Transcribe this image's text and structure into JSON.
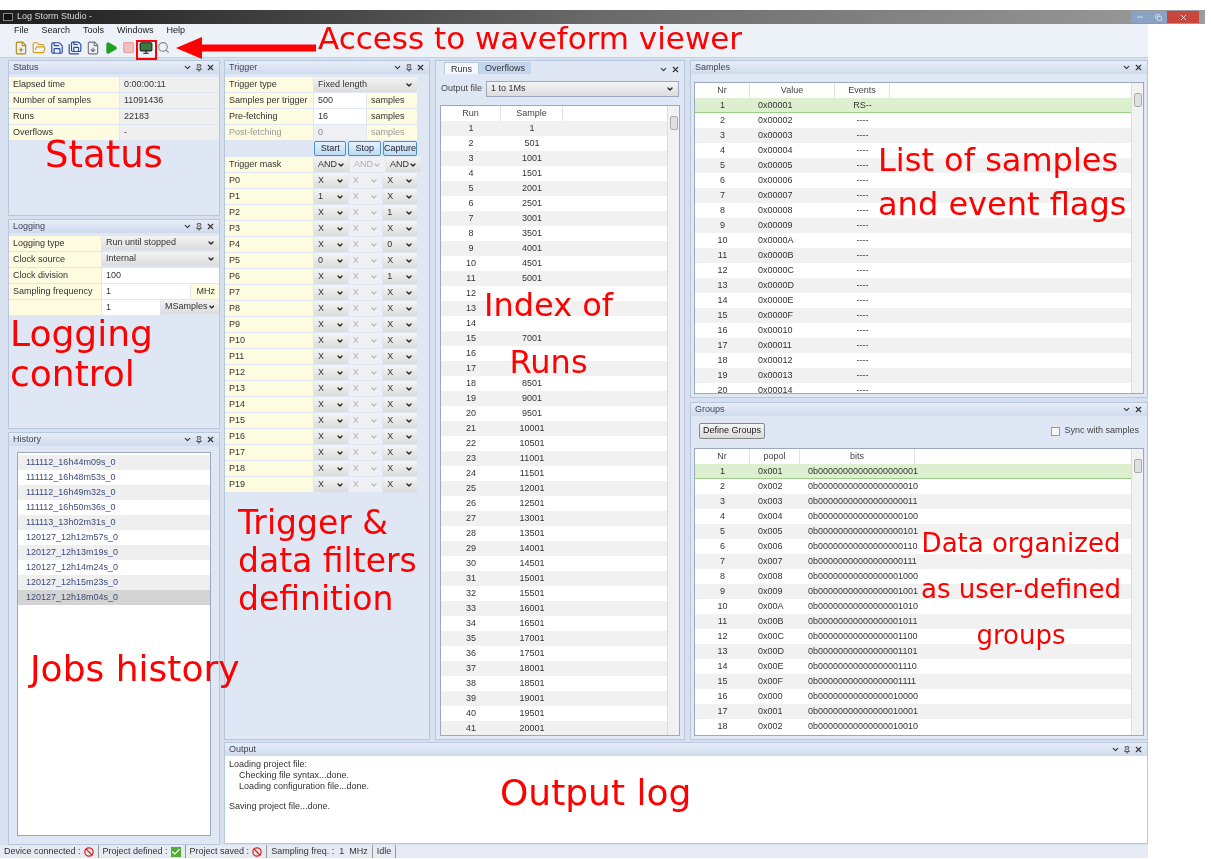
{
  "window": {
    "title": "Log Storm Studio -"
  },
  "menu": [
    "File",
    "Search",
    "Tools",
    "Windows",
    "Help"
  ],
  "status_panel": {
    "title": "Status",
    "rows": [
      {
        "label": "Elapsed time",
        "value": "0:00:00:11"
      },
      {
        "label": "Number of samples",
        "value": "11091436"
      },
      {
        "label": "Runs",
        "value": "22183"
      },
      {
        "label": "Overflows",
        "value": "-"
      }
    ]
  },
  "logging": {
    "title": "Logging",
    "settings": [
      {
        "kind": "select",
        "label": "Logging type",
        "value": "Run until stopped"
      },
      {
        "kind": "select",
        "label": "Clock source",
        "value": "Internal"
      },
      {
        "kind": "number",
        "label": "Clock division",
        "value": "100"
      },
      {
        "kind": "unit",
        "label": "Sampling frequency",
        "value": "1",
        "unit": "MHz"
      },
      {
        "kind": "unit_select",
        "value": "1",
        "unit": "MSamples"
      }
    ]
  },
  "history": {
    "title": "History",
    "items": [
      {
        "label": "111112_16h44m09s_0",
        "selected": false
      },
      {
        "label": "111112_16h48m53s_0",
        "selected": false
      },
      {
        "label": "111112_16h49m32s_0",
        "selected": false
      },
      {
        "label": "111112_16h50m36s_0",
        "selected": false
      },
      {
        "label": "111113_13h02m31s_0",
        "selected": false
      },
      {
        "label": "120127_12h12m57s_0",
        "selected": false
      },
      {
        "label": "120127_12h13m19s_0",
        "selected": false
      },
      {
        "label": "120127_12h14m24s_0",
        "selected": false
      },
      {
        "label": "120127_12h15m23s_0",
        "selected": false
      },
      {
        "label": "120127_12h18m04s_0",
        "selected": true
      }
    ]
  },
  "trigger": {
    "title": "Trigger",
    "settings": [
      {
        "kind": "select",
        "label": "Trigger type",
        "value": "Fixed length",
        "disabled": false
      },
      {
        "kind": "number",
        "label": "Samples per trigger",
        "value": "500",
        "unit": "samples",
        "disabled": false
      },
      {
        "kind": "number",
        "label": "Pre-fetching",
        "value": "16",
        "unit": "samples",
        "disabled": false
      },
      {
        "kind": "number",
        "label": "Post-fetching",
        "value": "0",
        "unit": "samples",
        "disabled": true
      }
    ],
    "buttons": [
      "Start",
      "Stop",
      "Capture"
    ],
    "mask": {
      "label": "Trigger mask",
      "values": [
        {
          "value": "AND",
          "disabled": false
        },
        {
          "value": "AND",
          "disabled": true
        },
        {
          "value": "AND",
          "disabled": false
        }
      ]
    },
    "pins": [
      {
        "label": "P0",
        "values": [
          "X",
          "X",
          "X"
        ]
      },
      {
        "label": "P1",
        "values": [
          "1",
          "X",
          "X"
        ]
      },
      {
        "label": "P2",
        "values": [
          "X",
          "X",
          "1"
        ]
      },
      {
        "label": "P3",
        "values": [
          "X",
          "X",
          "X"
        ]
      },
      {
        "label": "P4",
        "values": [
          "X",
          "X",
          "0"
        ]
      },
      {
        "label": "P5",
        "values": [
          "0",
          "X",
          "X"
        ]
      },
      {
        "label": "P6",
        "values": [
          "X",
          "X",
          "1"
        ]
      },
      {
        "label": "P7",
        "values": [
          "X",
          "X",
          "X"
        ]
      },
      {
        "label": "P8",
        "values": [
          "X",
          "X",
          "X"
        ]
      },
      {
        "label": "P9",
        "values": [
          "X",
          "X",
          "X"
        ]
      },
      {
        "label": "P10",
        "values": [
          "X",
          "X",
          "X"
        ]
      },
      {
        "label": "P11",
        "values": [
          "X",
          "X",
          "X"
        ]
      },
      {
        "label": "P12",
        "values": [
          "X",
          "X",
          "X"
        ]
      },
      {
        "label": "P13",
        "values": [
          "X",
          "X",
          "X"
        ]
      },
      {
        "label": "P14",
        "values": [
          "X",
          "X",
          "X"
        ]
      },
      {
        "label": "P15",
        "values": [
          "X",
          "X",
          "X"
        ]
      },
      {
        "label": "P16",
        "values": [
          "X",
          "X",
          "X"
        ]
      },
      {
        "label": "P17",
        "values": [
          "X",
          "X",
          "X"
        ]
      },
      {
        "label": "P18",
        "values": [
          "X",
          "X",
          "X"
        ]
      },
      {
        "label": "P19",
        "values": [
          "X",
          "X",
          "X"
        ]
      }
    ]
  },
  "runs": {
    "tabs": [
      {
        "label": "Runs",
        "selected": true
      },
      {
        "label": "Overflows",
        "selected": false
      }
    ],
    "output_file": {
      "label": "Output file",
      "value": "1 to 1Ms"
    },
    "columns": [
      "Run",
      "Sample"
    ],
    "rows": [
      {
        "run": "1",
        "sample": "1"
      },
      {
        "run": "2",
        "sample": "501"
      },
      {
        "run": "3",
        "sample": "1001"
      },
      {
        "run": "4",
        "sample": "1501"
      },
      {
        "run": "5",
        "sample": "2001"
      },
      {
        "run": "6",
        "sample": "2501"
      },
      {
        "run": "7",
        "sample": "3001"
      },
      {
        "run": "8",
        "sample": "3501"
      },
      {
        "run": "9",
        "sample": "4001"
      },
      {
        "run": "10",
        "sample": "4501"
      },
      {
        "run": "11",
        "sample": "5001"
      },
      {
        "run": "12"
      },
      {
        "run": "13"
      },
      {
        "run": "14"
      },
      {
        "run": "15",
        "sample": "7001"
      },
      {
        "run": "16"
      },
      {
        "run": "17"
      },
      {
        "run": "18",
        "sample": "8501"
      },
      {
        "run": "19",
        "sample": "9001"
      },
      {
        "run": "20",
        "sample": "9501"
      },
      {
        "run": "21",
        "sample": "10001"
      },
      {
        "run": "22",
        "sample": "10501"
      },
      {
        "run": "23",
        "sample": "11001"
      },
      {
        "run": "24",
        "sample": "11501"
      },
      {
        "run": "25",
        "sample": "12001"
      },
      {
        "run": "26",
        "sample": "12501"
      },
      {
        "run": "27",
        "sample": "13001"
      },
      {
        "run": "28",
        "sample": "13501"
      },
      {
        "run": "29",
        "sample": "14001"
      },
      {
        "run": "30",
        "sample": "14501"
      },
      {
        "run": "31",
        "sample": "15001"
      },
      {
        "run": "32",
        "sample": "15501"
      },
      {
        "run": "33",
        "sample": "16001"
      },
      {
        "run": "34",
        "sample": "16501"
      },
      {
        "run": "35",
        "sample": "17001"
      },
      {
        "run": "36",
        "sample": "17501"
      },
      {
        "run": "37",
        "sample": "18001"
      },
      {
        "run": "38",
        "sample": "18501"
      },
      {
        "run": "39",
        "sample": "19001"
      },
      {
        "run": "40",
        "sample": "19501"
      },
      {
        "run": "41",
        "sample": "20001"
      }
    ]
  },
  "samples": {
    "title": "Samples",
    "columns": [
      "Nr",
      "Value",
      "Events"
    ],
    "rows": [
      {
        "nr": "1",
        "value": "0x00001",
        "events": "RS--",
        "selected": true
      },
      {
        "nr": "2",
        "value": "0x00002",
        "events": "----",
        "selected": false
      },
      {
        "nr": "3",
        "value": "0x00003",
        "events": "----",
        "selected": false
      },
      {
        "nr": "4",
        "value": "0x00004",
        "events": "----",
        "selected": false
      },
      {
        "nr": "5",
        "value": "0x00005",
        "events": "----",
        "selected": false
      },
      {
        "nr": "6",
        "value": "0x00006",
        "events": "----",
        "selected": false
      },
      {
        "nr": "7",
        "value": "0x00007",
        "events": "----",
        "selected": false
      },
      {
        "nr": "8",
        "value": "0x00008",
        "events": "----",
        "selected": false
      },
      {
        "nr": "9",
        "value": "0x00009",
        "events": "----",
        "selected": false
      },
      {
        "nr": "10",
        "value": "0x0000A",
        "events": "----",
        "selected": false
      },
      {
        "nr": "11",
        "value": "0x0000B",
        "events": "----",
        "selected": false
      },
      {
        "nr": "12",
        "value": "0x0000C",
        "events": "----",
        "selected": false
      },
      {
        "nr": "13",
        "value": "0x0000D",
        "events": "----",
        "selected": false
      },
      {
        "nr": "14",
        "value": "0x0000E",
        "events": "----",
        "selected": false
      },
      {
        "nr": "15",
        "value": "0x0000F",
        "events": "----",
        "selected": false
      },
      {
        "nr": "16",
        "value": "0x00010",
        "events": "----",
        "selected": false
      },
      {
        "nr": "17",
        "value": "0x00011",
        "events": "----",
        "selected": false
      },
      {
        "nr": "18",
        "value": "0x00012",
        "events": "----",
        "selected": false
      },
      {
        "nr": "19",
        "value": "0x00013",
        "events": "----",
        "selected": false
      },
      {
        "nr": "20",
        "value": "0x00014",
        "events": "----",
        "selected": false
      }
    ]
  },
  "groups": {
    "title": "Groups",
    "define_button": "Define Groups",
    "sync": {
      "label": "Sync with samples",
      "checked": false
    },
    "columns": [
      "Nr",
      "popol",
      "bits"
    ],
    "rows": [
      {
        "nr": "1",
        "popol": "0x001",
        "bits": "0b00000000000000000001",
        "selected": true
      },
      {
        "nr": "2",
        "popol": "0x002",
        "bits": "0b00000000000000000010",
        "selected": false
      },
      {
        "nr": "3",
        "popol": "0x003",
        "bits": "0b00000000000000000011",
        "selected": false
      },
      {
        "nr": "4",
        "popol": "0x004",
        "bits": "0b00000000000000000100",
        "selected": false
      },
      {
        "nr": "5",
        "popol": "0x005",
        "bits": "0b00000000000000000101",
        "selected": false
      },
      {
        "nr": "6",
        "popol": "0x006",
        "bits": "0b00000000000000000110",
        "selected": false
      },
      {
        "nr": "7",
        "popol": "0x007",
        "bits": "0b00000000000000000111",
        "selected": false
      },
      {
        "nr": "8",
        "popol": "0x008",
        "bits": "0b00000000000000001000",
        "selected": false
      },
      {
        "nr": "9",
        "popol": "0x009",
        "bits": "0b00000000000000001001",
        "selected": false
      },
      {
        "nr": "10",
        "popol": "0x00A",
        "bits": "0b00000000000000001010",
        "selected": false
      },
      {
        "nr": "11",
        "popol": "0x00B",
        "bits": "0b00000000000000001011",
        "selected": false
      },
      {
        "nr": "12",
        "popol": "0x00C",
        "bits": "0b00000000000000001100",
        "selected": false
      },
      {
        "nr": "13",
        "popol": "0x00D",
        "bits": "0b00000000000000001101",
        "selected": false
      },
      {
        "nr": "14",
        "popol": "0x00E",
        "bits": "0b00000000000000001110",
        "selected": false
      },
      {
        "nr": "15",
        "popol": "0x00F",
        "bits": "0b00000000000000001111",
        "selected": false
      },
      {
        "nr": "16",
        "popol": "0x000",
        "bits": "0b00000000000000010000",
        "selected": false
      },
      {
        "nr": "17",
        "popol": "0x001",
        "bits": "0b00000000000000010001",
        "selected": false
      },
      {
        "nr": "18",
        "popol": "0x002",
        "bits": "0b00000000000000010010",
        "selected": false
      }
    ]
  },
  "output": {
    "title": "Output",
    "lines": [
      {
        "text": "Loading project file:",
        "children": [
          {
            "text": "Checking file syntax...done."
          },
          {
            "text": "Loading configuration file...done."
          }
        ]
      },
      {
        "text": "Saving project file...done."
      }
    ]
  },
  "status_bar": [
    {
      "kind": "indicator",
      "label": "Device connected :",
      "ok": false
    },
    {
      "kind": "indicator",
      "label": "Project defined :",
      "ok": true
    },
    {
      "kind": "indicator",
      "label": "Project saved :",
      "ok": false
    },
    {
      "kind": "text",
      "label": "Sampling freq. :  1  MHz"
    },
    {
      "kind": "text",
      "label": "Idle"
    }
  ],
  "annotations": [
    {
      "kind": "toolbar",
      "lines": [
        "Access to waveform viewer"
      ]
    },
    {
      "kind": "status",
      "lines": [
        "Status"
      ]
    },
    {
      "kind": "logging",
      "lines": [
        "Logging",
        "control"
      ]
    },
    {
      "kind": "trigger",
      "lines": [
        "Trigger &",
        "data filters",
        "definition"
      ]
    },
    {
      "kind": "runs",
      "lines": [
        "Index of",
        "Runs"
      ]
    },
    {
      "kind": "samples",
      "lines": [
        "List of samples",
        "and event flags"
      ]
    },
    {
      "kind": "groups",
      "lines": [
        "Data organized",
        "as user-defined",
        "groups"
      ]
    },
    {
      "kind": "history",
      "lines": [
        "Jobs history"
      ]
    },
    {
      "kind": "output",
      "lines": [
        "Output log"
      ]
    }
  ]
}
